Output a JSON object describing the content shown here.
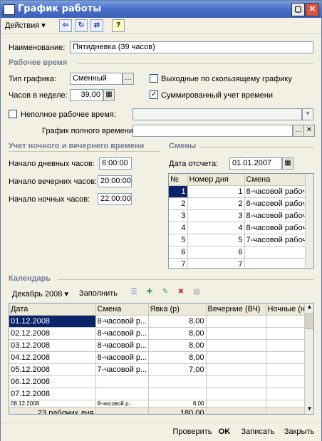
{
  "window": {
    "title": "График работы"
  },
  "toolbar": {
    "actions_label": "Действия",
    "help_label": "?"
  },
  "form": {
    "name_label": "Наименование:",
    "name_value": "Пятидневка (39 часов)",
    "work_time_section": "Рабочее время",
    "schedule_type_label": "Тип графика:",
    "schedule_type_value": "Сменный",
    "weekly_hours_label": "Часов в неделе:",
    "weekly_hours_value": "39,00",
    "sliding_days_off_label": "Выходные по скользящему графику",
    "sliding_days_off_checked": false,
    "summed_accounting_label": "Суммированный учет времени",
    "summed_accounting_checked": true,
    "part_time_label": "Неполное рабочее время:",
    "part_time_checked": false,
    "full_time_schedule_label": "График полного времени:"
  },
  "night": {
    "section": "Учет ночного и вечернего времени",
    "day_start_label": "Начало дневных часов:",
    "day_start_value": "6:00:00",
    "evening_start_label": "Начало вечерних часов:",
    "evening_start_value": "20:00:00",
    "night_start_label": "Начало ночных часов:",
    "night_start_value": "22:00:00"
  },
  "shifts": {
    "section": "Смены",
    "ref_date_label": "Дата отсчета:",
    "ref_date_value": "01.01.2007",
    "columns": [
      "№",
      "Номер дня",
      "Смена"
    ],
    "rows": [
      {
        "n": "1",
        "day": "1",
        "shift": "8-часовой рабоч..."
      },
      {
        "n": "2",
        "day": "2",
        "shift": "8-часовой рабоч..."
      },
      {
        "n": "3",
        "day": "3",
        "shift": "8-часовой рабоч..."
      },
      {
        "n": "4",
        "day": "4",
        "shift": "8-часовой рабоч..."
      },
      {
        "n": "5",
        "day": "5",
        "shift": "7-часовой рабоч..."
      },
      {
        "n": "6",
        "day": "6",
        "shift": ""
      },
      {
        "n": "7",
        "day": "7",
        "shift": ""
      }
    ]
  },
  "calendar": {
    "section": "Календарь",
    "month_label": "Декабрь 2008",
    "fill_label": "Заполнить",
    "columns": [
      "Дата",
      "Смена",
      "Явка (р)",
      "Вечерние (ВЧ)",
      "Ночные (н"
    ],
    "rows": [
      {
        "date": "01.12.2008",
        "shift": "8-часовой р...",
        "att": "8,00"
      },
      {
        "date": "02.12.2008",
        "shift": "8-часовой р...",
        "att": "8,00"
      },
      {
        "date": "03.12.2008",
        "shift": "8-часовой р...",
        "att": "8,00"
      },
      {
        "date": "04.12.2008",
        "shift": "8-часовой р...",
        "att": "8,00"
      },
      {
        "date": "05.12.2008",
        "shift": "7-часовой р...",
        "att": "7,00"
      },
      {
        "date": "06.12.2008",
        "shift": "",
        "att": ""
      },
      {
        "date": "07.12.2008",
        "shift": "",
        "att": ""
      },
      {
        "date": "08.12.2008",
        "shift": "8-часовой р...",
        "att": "8,00"
      }
    ],
    "footer_days": "23 рабочих дня",
    "footer_total": "180,00"
  },
  "buttons": {
    "check": "Проверить",
    "ok": "OK",
    "save": "Записать",
    "close": "Закрыть"
  }
}
